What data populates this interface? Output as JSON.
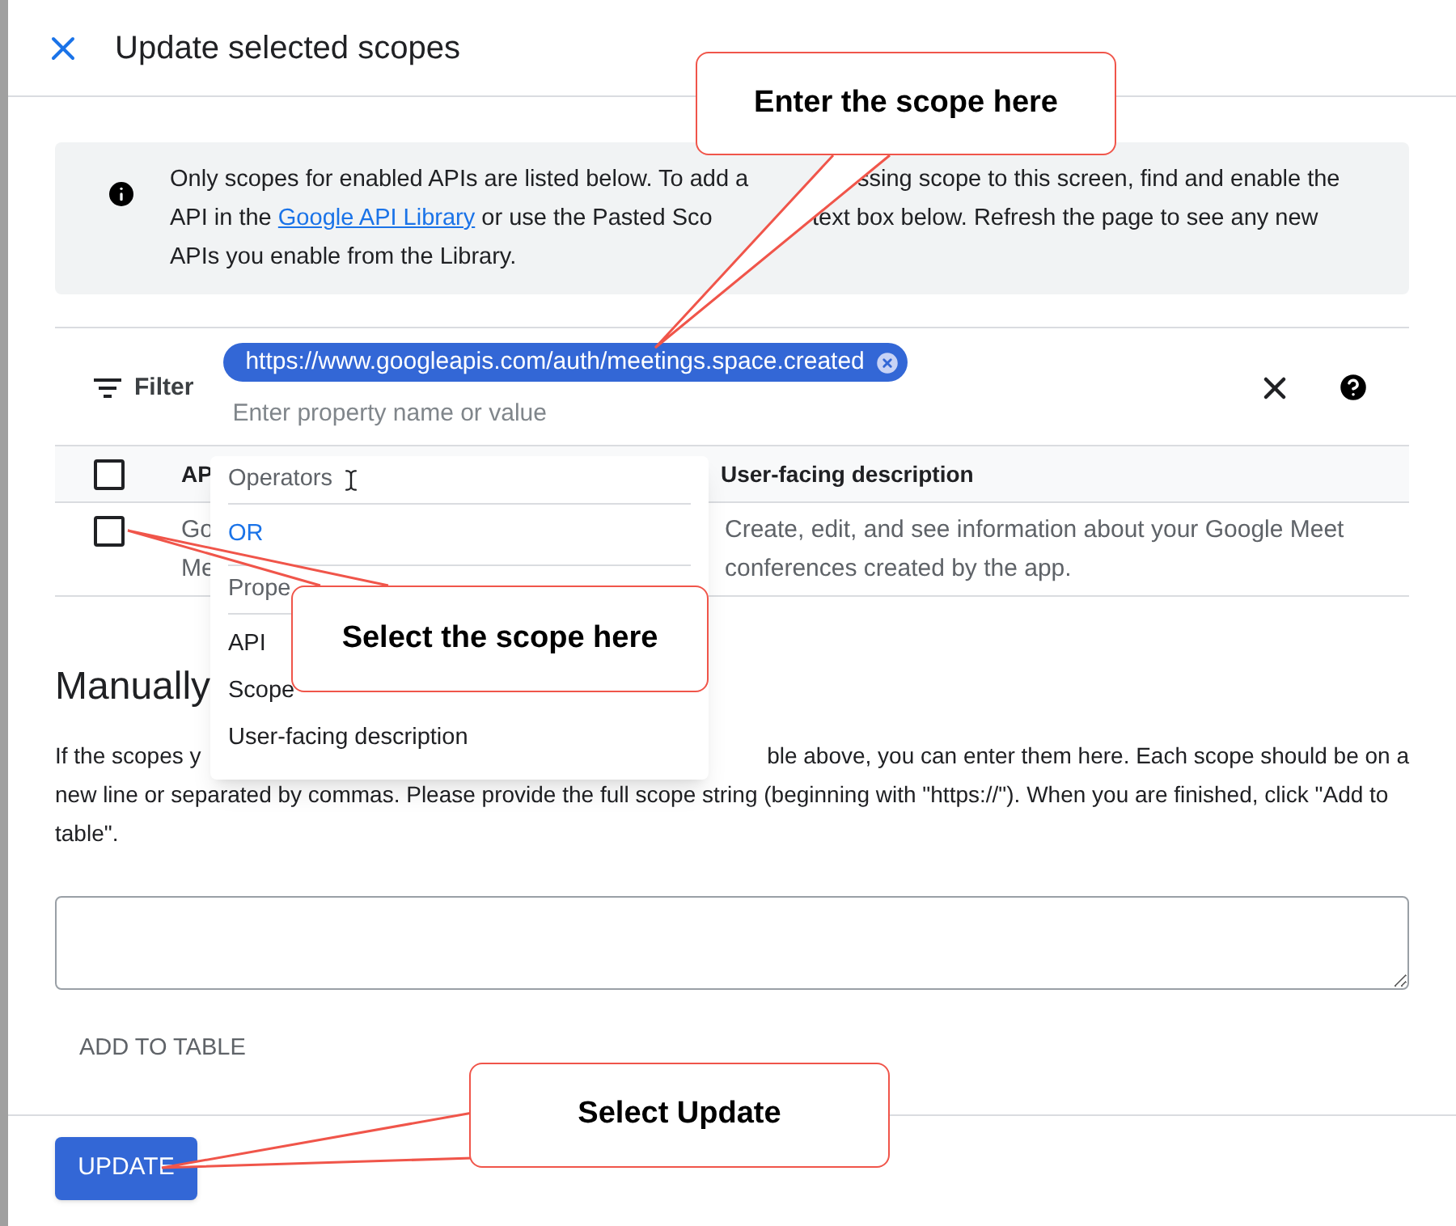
{
  "dialog": {
    "title": "Update selected scopes"
  },
  "info": {
    "lines": [
      {
        "left": "Only scopes for enabled APIs are listed below. To add a",
        "right": "ssing scope to this screen, find and enable the"
      },
      {
        "left": "API in the ",
        "link": "Google API Library",
        "after_link": " or use the Pasted Sco",
        "right": "text box below. Refresh the page to see any new"
      },
      {
        "left": "APIs you enable from the Library."
      }
    ]
  },
  "filter": {
    "label": "Filter",
    "chip": "https://www.googleapis.com/auth/meetings.space.created",
    "placeholder": "Enter property name or value"
  },
  "table": {
    "header_checked": false,
    "columns": [
      "AP",
      "User-facing description"
    ],
    "rows": [
      {
        "checked": false,
        "api_fragments": [
          "Go",
          "Me"
        ],
        "description": "Create, edit, and see information about your Google Meet conferences created by the app."
      }
    ]
  },
  "manual": {
    "heading": "Manually",
    "text_left": "If the scopes y",
    "text_right": "ble above, you can enter them here. Each scope should be on a",
    "text_rest": "new line or separated by commas. Please provide the full scope string (beginning with \"https://\"). When you are finished, click \"Add to table\".",
    "add_button": "ADD TO TABLE"
  },
  "update_button": "UPDATE",
  "dropdown": [
    {
      "heading": "Operators",
      "items": [
        {
          "label": "OR",
          "kind": "operator"
        }
      ]
    },
    {
      "heading": "Prope",
      "items": [
        {
          "label": "API",
          "kind": "property"
        },
        {
          "label": "Scope",
          "kind": "property"
        },
        {
          "label": "User-facing description",
          "kind": "property"
        }
      ]
    }
  ],
  "callouts": [
    "Enter the scope here",
    "Select the scope here",
    "Select Update"
  ]
}
